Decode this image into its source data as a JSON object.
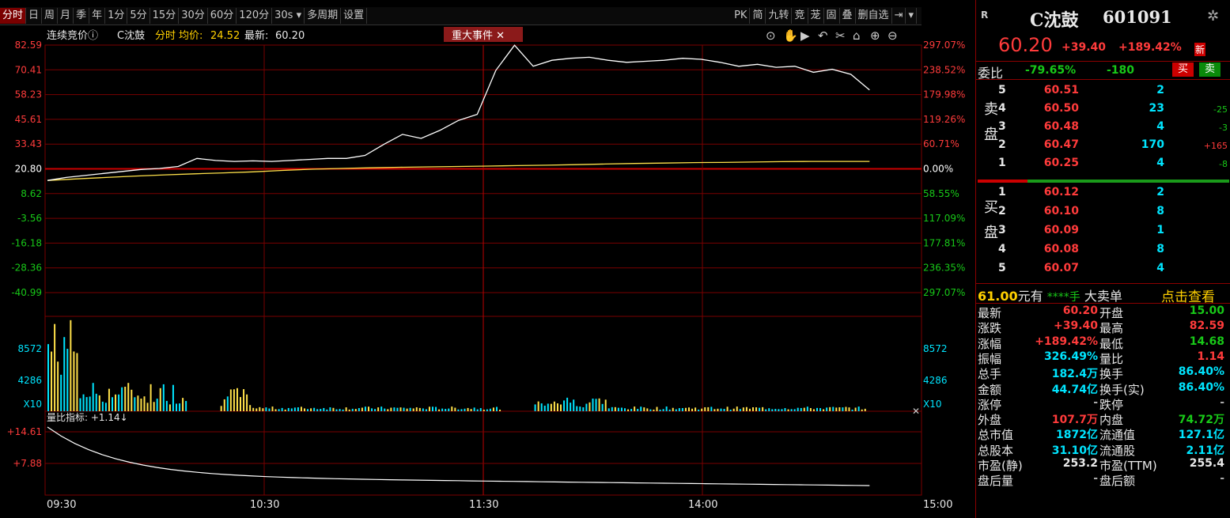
{
  "toolbar": {
    "items": [
      "分时",
      "日",
      "周",
      "月",
      "季",
      "年",
      "1分",
      "5分",
      "15分",
      "30分",
      "60分",
      "120分",
      "30s ▾",
      "多周期",
      "设置"
    ],
    "right_items": [
      "PK",
      "简",
      "九转",
      "竞",
      "茏",
      "固",
      "叠",
      "删自选",
      "⇥",
      "▾"
    ]
  },
  "header": {
    "phase": "连续竞价ⓘ",
    "stock": "C沈鼓",
    "mode": "分时",
    "avg_label": "均价:",
    "avg_value": "24.52",
    "last_label": "最新:",
    "last_value": "60.20",
    "event_button": "重大事件 ✕"
  },
  "chart_data": {
    "type": "line",
    "title": "C沈鼓 分时",
    "x_ticks": [
      "09:30",
      "10:30",
      "11:30",
      "14:00",
      "15:00"
    ],
    "price_axis_left": [
      "82.59",
      "70.41",
      "58.23",
      "45.61",
      "33.43",
      "20.80",
      "8.62",
      "-3.56",
      "-16.18",
      "-28.36",
      "-40.99"
    ],
    "pct_axis_right": [
      "297.07%",
      "238.52%",
      "179.98%",
      "119.26%",
      "60.71%",
      "0.00%",
      "58.55%",
      "117.09%",
      "177.81%",
      "236.35%",
      "297.07%"
    ],
    "prev_close": 20.8,
    "ylim": [
      -40.99,
      82.59
    ],
    "price_series": [
      15.0,
      16.5,
      17.5,
      18.5,
      19.5,
      20.5,
      21.0,
      22.0,
      26.0,
      25.0,
      24.5,
      24.8,
      24.5,
      25.0,
      25.5,
      26.0,
      26.0,
      27.5,
      33.0,
      38.0,
      36.0,
      40.0,
      45.0,
      48.0,
      70.0,
      82.5,
      72.0,
      75.0,
      76.0,
      76.5,
      75.0,
      74.0,
      74.5,
      75.0,
      76.0,
      75.5,
      74.0,
      72.0,
      73.0,
      71.5,
      72.0,
      69.0,
      70.5,
      68.0,
      60.2
    ],
    "avg_series": [
      15.0,
      15.8,
      16.5,
      17.2,
      17.8,
      18.3,
      18.8,
      19.3,
      20.0,
      20.6,
      21.0,
      21.3,
      21.6,
      21.8,
      22.0,
      22.2,
      22.4,
      22.6,
      22.9,
      23.2,
      23.5,
      23.7,
      23.9,
      24.0,
      24.2,
      24.4,
      24.5,
      24.5,
      24.52
    ],
    "volume_axis": [
      "8572",
      "4286",
      "X10"
    ],
    "volume_ratio_label": "量比指标: +1.14↓",
    "volume_ratio_axis": [
      "+14.61",
      "+7.88"
    ]
  },
  "quote": {
    "badge": "R",
    "name": "C沈鼓",
    "code": "601091",
    "price": "60.20",
    "change": "+39.40",
    "change_pct": "+189.42%",
    "new_tag": "新",
    "weibi_label": "委比",
    "weibi_pct": "-79.65%",
    "weibi_diff": "-180",
    "buy_btn": "买",
    "sell_btn": "卖",
    "sell_label": "卖盘",
    "buy_label": "买盘",
    "asks": [
      {
        "lvl": "5",
        "price": "60.51",
        "vol": "2",
        "chg": ""
      },
      {
        "lvl": "4",
        "price": "60.50",
        "vol": "23",
        "chg": "-25"
      },
      {
        "lvl": "3",
        "price": "60.48",
        "vol": "4",
        "chg": "-3"
      },
      {
        "lvl": "2",
        "price": "60.47",
        "vol": "170",
        "chg": "+165"
      },
      {
        "lvl": "1",
        "price": "60.25",
        "vol": "4",
        "chg": "-8"
      }
    ],
    "bids": [
      {
        "lvl": "1",
        "price": "60.12",
        "vol": "2"
      },
      {
        "lvl": "2",
        "price": "60.10",
        "vol": "8"
      },
      {
        "lvl": "3",
        "price": "60.09",
        "vol": "1"
      },
      {
        "lvl": "4",
        "price": "60.08",
        "vol": "8"
      },
      {
        "lvl": "5",
        "price": "60.07",
        "vol": "4"
      }
    ],
    "big_order": {
      "price": "61.00",
      "text1": "元有",
      "stars": "****手",
      "text2": "大卖单",
      "link": "点击查看"
    },
    "stats": [
      {
        "l1": "最新",
        "v1": "60.20",
        "c1": "red",
        "l2": "开盘",
        "v2": "15.00",
        "c2": "green"
      },
      {
        "l1": "涨跌",
        "v1": "+39.40",
        "c1": "red",
        "l2": "最高",
        "v2": "82.59",
        "c2": "red"
      },
      {
        "l1": "涨幅",
        "v1": "+189.42%",
        "c1": "red",
        "l2": "最低",
        "v2": "14.68",
        "c2": "green"
      },
      {
        "l1": "振幅",
        "v1": "326.49%",
        "c1": "cyan",
        "l2": "量比",
        "v2": "1.14",
        "c2": "red"
      },
      {
        "l1": "总手",
        "v1": "182.4万",
        "c1": "cyan",
        "l2": "换手",
        "v2": "86.40%",
        "c2": "cyan"
      },
      {
        "l1": "金额",
        "v1": "44.74亿",
        "c1": "cyan",
        "l2": "换手(实)",
        "v2": "86.40%",
        "c2": "cyan"
      },
      {
        "l1": "涨停",
        "v1": "-",
        "c1": "gray",
        "l2": "跌停",
        "v2": "-",
        "c2": "gray"
      },
      {
        "l1": "外盘",
        "v1": "107.7万",
        "c1": "red",
        "l2": "内盘",
        "v2": "74.72万",
        "c2": "green"
      },
      {
        "l1": "总市值",
        "v1": "1872亿",
        "c1": "cyan",
        "l2": "流通值",
        "v2": "127.1亿",
        "c2": "cyan"
      },
      {
        "l1": "总股本",
        "v1": "31.10亿",
        "c1": "cyan",
        "l2": "流通股",
        "v2": "2.11亿",
        "c2": "cyan"
      },
      {
        "l1": "市盈(静)",
        "v1": "253.2",
        "c1": "white",
        "l2": "市盈(TTM)",
        "v2": "255.4",
        "c2": "white"
      },
      {
        "l1": "盘后量",
        "v1": "-",
        "c1": "gray",
        "l2": "盘后额",
        "v2": "-",
        "c2": "gray"
      }
    ]
  },
  "colors": {
    "up": "#ff3b3b",
    "down": "#18c818",
    "grid": "#7a0000",
    "price_line": "#ffffff",
    "avg_line": "#ffe14a",
    "accent": "#00e5ff"
  }
}
